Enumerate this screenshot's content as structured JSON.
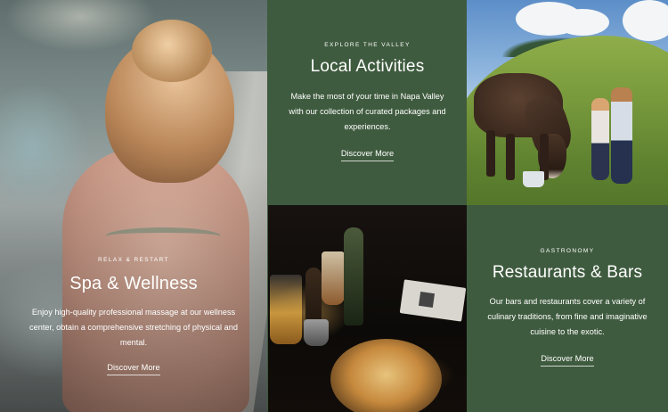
{
  "tiles": {
    "spa": {
      "eyebrow": "RELAX & RESTART",
      "title": "Spa & Wellness",
      "description": "Enjoy high-quality professional massage at our wellness center, obtain a comprehensive stretching of physical and mental.",
      "cta": "Discover More",
      "photo_icon": "woman-in-hot-tub-photo"
    },
    "activities": {
      "eyebrow": "EXPLORE THE VALLEY",
      "title": "Local Activities",
      "description": "Make the most of your time in Napa Valley with our collection of curated packages and experiences.",
      "cta": "Discover More",
      "background": "#3f5b3f"
    },
    "cow_photo": {
      "photo_icon": "children-with-cow-photo"
    },
    "food_photo": {
      "photo_icon": "restaurant-dish-photo"
    },
    "restaurants": {
      "eyebrow": "GASTRONOMY",
      "title": "Restaurants & Bars",
      "description": "Our bars and restaurants cover a variety of culinary traditions, from fine and imaginative cuisine to the exotic.",
      "cta": "Discover More",
      "background": "#3f5b3f"
    }
  }
}
